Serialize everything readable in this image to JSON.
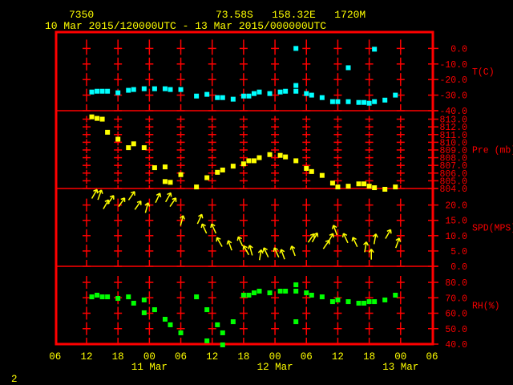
{
  "header": {
    "station": "7350",
    "location": "73.58S   158.32E   1720M",
    "period": "10 Mar 2015/120000UTC - 13 Mar 2015/000000UTC"
  },
  "footer": {
    "page": "2"
  },
  "colors": {
    "background": "#000000",
    "frame": "#ff0000",
    "text": "#ffff00",
    "temp": "#00ffff",
    "pressure": "#ffff00",
    "wind": "#ffff00",
    "rh": "#00ff00"
  },
  "chart_data": {
    "type": "scatter",
    "title": "Station 7350 meteogram",
    "x_units": "hours since 10 Mar 2015 12UTC",
    "xlim": [
      -6,
      66
    ],
    "x_ticks": [
      {
        "h": -6,
        "label": "06"
      },
      {
        "h": 0,
        "label": "12"
      },
      {
        "h": 6,
        "label": "18"
      },
      {
        "h": 12,
        "label": "00"
      },
      {
        "h": 18,
        "label": "06"
      },
      {
        "h": 24,
        "label": "12"
      },
      {
        "h": 30,
        "label": "18"
      },
      {
        "h": 36,
        "label": "00"
      },
      {
        "h": 42,
        "label": "06"
      },
      {
        "h": 48,
        "label": "12"
      },
      {
        "h": 54,
        "label": "18"
      },
      {
        "h": 60,
        "label": "00"
      },
      {
        "h": 66,
        "label": "06"
      }
    ],
    "date_labels": [
      {
        "h": 12,
        "label": "11 Mar"
      },
      {
        "h": 36,
        "label": "12 Mar"
      },
      {
        "h": 60,
        "label": "13 Mar"
      }
    ],
    "grid": true,
    "panels": [
      {
        "name": "temperature",
        "ylabel": "T(C)",
        "ylim": [
          -40,
          10.5
        ],
        "color": "#00ffff",
        "ticks": [
          {
            "v": 0,
            "label": "0.0"
          },
          {
            "v": -10,
            "label": "-10.0"
          },
          {
            "v": -20,
            "label": "-20.0"
          },
          {
            "v": -30,
            "label": "-30.0"
          },
          {
            "v": -40,
            "label": "-40.0"
          }
        ],
        "points": [
          [
            1,
            -28.0
          ],
          [
            2,
            -27.5
          ],
          [
            3,
            -27.5
          ],
          [
            4,
            -27.5
          ],
          [
            6,
            -28.5
          ],
          [
            8,
            -26.9
          ],
          [
            9,
            -26.4
          ],
          [
            11,
            -25.9
          ],
          [
            13,
            -25.9
          ],
          [
            15,
            -25.9
          ],
          [
            16,
            -26.4
          ],
          [
            18,
            -26.4
          ],
          [
            21,
            -30.6
          ],
          [
            23,
            -29.5
          ],
          [
            25,
            -31.6
          ],
          [
            26,
            -31.6
          ],
          [
            28,
            -32.6
          ],
          [
            30,
            -30.6
          ],
          [
            31,
            -30.6
          ],
          [
            32,
            -29.0
          ],
          [
            33,
            -28.0
          ],
          [
            35,
            -29.0
          ],
          [
            37,
            -28.0
          ],
          [
            38,
            -27.5
          ],
          [
            40,
            -27.5
          ],
          [
            40,
            -23.8
          ],
          [
            40,
            0.0
          ],
          [
            42,
            -29.0
          ],
          [
            43,
            -30.0
          ],
          [
            45,
            -31.6
          ],
          [
            47,
            -34.2
          ],
          [
            48,
            -34.2
          ],
          [
            50,
            -34.2
          ],
          [
            50,
            -12.4
          ],
          [
            52,
            -34.7
          ],
          [
            53,
            -34.7
          ],
          [
            54,
            -35.2
          ],
          [
            55,
            -34.2
          ],
          [
            55,
            -0.5
          ],
          [
            57,
            -33.2
          ],
          [
            59,
            -30.0
          ]
        ]
      },
      {
        "name": "pressure",
        "ylabel": "Pre (mb)",
        "ylim": [
          804,
          814.1
        ],
        "color": "#ffff00",
        "ticks": [
          {
            "v": 813,
            "label": "813.0"
          },
          {
            "v": 812,
            "label": "812.0"
          },
          {
            "v": 811,
            "label": "811.0"
          },
          {
            "v": 810,
            "label": "810.0"
          },
          {
            "v": 809,
            "label": "809.0"
          },
          {
            "v": 808,
            "label": "808.0"
          },
          {
            "v": 807,
            "label": "807.0"
          },
          {
            "v": 806,
            "label": "806.0"
          },
          {
            "v": 805,
            "label": "805.0"
          },
          {
            "v": 804,
            "label": "804.0"
          }
        ],
        "points": [
          [
            1,
            813.3
          ],
          [
            2,
            813.1
          ],
          [
            3,
            813.0
          ],
          [
            4,
            811.3
          ],
          [
            6,
            810.4
          ],
          [
            8,
            809.3
          ],
          [
            9,
            809.8
          ],
          [
            11,
            809.3
          ],
          [
            13,
            806.7
          ],
          [
            15,
            806.8
          ],
          [
            15,
            804.9
          ],
          [
            16,
            804.8
          ],
          [
            18,
            805.8
          ],
          [
            21,
            804.2
          ],
          [
            23,
            805.4
          ],
          [
            25,
            806.1
          ],
          [
            26,
            806.4
          ],
          [
            28,
            806.9
          ],
          [
            30,
            807.2
          ],
          [
            31,
            807.6
          ],
          [
            32,
            807.6
          ],
          [
            33,
            808.0
          ],
          [
            35,
            808.4
          ],
          [
            37,
            808.3
          ],
          [
            38,
            808.1
          ],
          [
            40,
            807.6
          ],
          [
            42,
            806.6
          ],
          [
            43,
            806.2
          ],
          [
            45,
            805.7
          ],
          [
            47,
            804.7
          ],
          [
            48,
            804.2
          ],
          [
            50,
            804.3
          ],
          [
            52,
            804.6
          ],
          [
            53,
            804.6
          ],
          [
            54,
            804.3
          ],
          [
            55,
            804.1
          ],
          [
            57,
            803.9
          ],
          [
            59,
            804.2
          ]
        ]
      },
      {
        "name": "wind",
        "ylabel": "SPD(MPS)",
        "ylim": [
          0,
          25.4
        ],
        "color": "#ffff00",
        "ticks": [
          {
            "v": 20,
            "label": "20.0"
          },
          {
            "v": 15,
            "label": "15.0"
          },
          {
            "v": 10,
            "label": "10.0"
          },
          {
            "v": 5,
            "label": "5.0"
          },
          {
            "v": 0,
            "label": "0.0"
          }
        ],
        "points_h_speed_dir": [
          [
            1.5,
            23.6,
            30
          ],
          [
            2.5,
            23.3,
            20
          ],
          [
            3.7,
            20.2,
            30
          ],
          [
            4.6,
            21.7,
            35
          ],
          [
            6.7,
            20.9,
            35
          ],
          [
            8.6,
            23.0,
            35
          ],
          [
            9.8,
            19.9,
            35
          ],
          [
            11.5,
            19.1,
            15
          ],
          [
            13.6,
            22.3,
            25
          ],
          [
            15.6,
            22.5,
            30
          ],
          [
            16.5,
            20.9,
            35
          ],
          [
            18.2,
            14.9,
            15
          ],
          [
            21.6,
            15.4,
            25
          ],
          [
            22.5,
            12.3,
            -25
          ],
          [
            24.3,
            12.3,
            -25
          ],
          [
            25.4,
            7.9,
            -30
          ],
          [
            27.4,
            6.8,
            -20
          ],
          [
            29.4,
            8.1,
            -25
          ],
          [
            30.5,
            5.2,
            -30
          ],
          [
            31.4,
            5.2,
            -15
          ],
          [
            33.2,
            3.7,
            10
          ],
          [
            34.3,
            4.5,
            -25
          ],
          [
            36.3,
            4.5,
            -25
          ],
          [
            37.5,
            3.9,
            -20
          ],
          [
            39.5,
            5.0,
            -20
          ],
          [
            42.9,
            9.2,
            35
          ],
          [
            43.6,
            9.4,
            30
          ],
          [
            45.8,
            7.1,
            35
          ],
          [
            46.6,
            9.2,
            30
          ],
          [
            47.5,
            11.8,
            -20
          ],
          [
            49.5,
            9.2,
            -25
          ],
          [
            51.3,
            7.9,
            -25
          ],
          [
            53.3,
            6.3,
            10
          ],
          [
            54.4,
            3.9,
            0
          ],
          [
            55.1,
            8.9,
            10
          ],
          [
            57.6,
            10.5,
            30
          ],
          [
            59.4,
            7.6,
            20
          ]
        ]
      },
      {
        "name": "humidity",
        "ylabel": "RH(%)",
        "ylim": [
          40,
          90.4
        ],
        "color": "#00ff00",
        "ticks": [
          {
            "v": 80,
            "label": "80.0"
          },
          {
            "v": 70,
            "label": "70.0"
          },
          {
            "v": 60,
            "label": "60.0"
          },
          {
            "v": 50,
            "label": "50.0"
          },
          {
            "v": 40,
            "label": "40.0"
          }
        ],
        "points": [
          [
            1,
            70.6
          ],
          [
            2,
            71.7
          ],
          [
            3,
            70.6
          ],
          [
            4,
            70.6
          ],
          [
            6,
            69.6
          ],
          [
            8,
            70.6
          ],
          [
            9,
            66.5
          ],
          [
            11,
            68.6
          ],
          [
            11,
            60.3
          ],
          [
            13,
            62.3
          ],
          [
            15,
            56.1
          ],
          [
            16,
            52.5
          ],
          [
            18,
            47.3
          ],
          [
            21,
            70.6
          ],
          [
            23,
            62.3
          ],
          [
            23,
            42.1
          ],
          [
            25,
            52.5
          ],
          [
            26,
            47.3
          ],
          [
            26,
            39.5
          ],
          [
            28,
            54.5
          ],
          [
            30,
            71.7
          ],
          [
            31,
            71.7
          ],
          [
            32,
            73.2
          ],
          [
            33,
            74.3
          ],
          [
            35,
            73.2
          ],
          [
            37,
            74.3
          ],
          [
            38,
            74.3
          ],
          [
            40,
            78.4
          ],
          [
            40,
            74.3
          ],
          [
            40,
            54.5
          ],
          [
            42,
            73.2
          ],
          [
            43,
            71.7
          ],
          [
            45,
            70.6
          ],
          [
            47,
            67.5
          ],
          [
            48,
            68.6
          ],
          [
            50,
            67.5
          ],
          [
            52,
            66.5
          ],
          [
            53,
            66.5
          ],
          [
            54,
            67.5
          ],
          [
            55,
            67.5
          ],
          [
            57,
            68.6
          ],
          [
            59,
            71.7
          ]
        ]
      }
    ]
  }
}
